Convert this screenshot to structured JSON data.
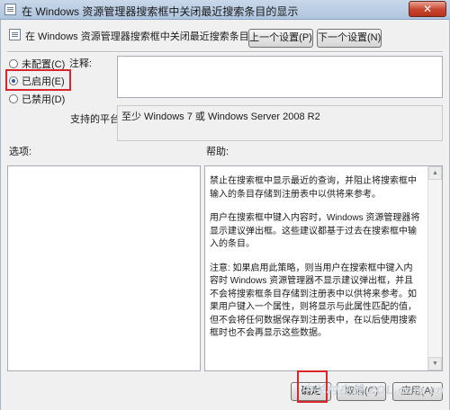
{
  "window": {
    "title": "在 Windows 资源管理器搜索框中关闭最近搜索条目的显示",
    "close_symbol": "✕"
  },
  "header": {
    "title": "在 Windows 资源管理器搜索框中关闭最近搜索条目的显示",
    "prev_button": "上一个设置(P)",
    "next_button": "下一个设置(N)"
  },
  "state_options": [
    {
      "label": "未配置(C)",
      "checked": false
    },
    {
      "label": "已启用(E)",
      "checked": true
    },
    {
      "label": "已禁用(D)",
      "checked": false
    }
  ],
  "comment": {
    "label": "注释:",
    "value": ""
  },
  "supported_on": {
    "label": "支持的平台:",
    "value": "至少 Windows 7 或 Windows Server 2008 R2"
  },
  "options": {
    "label": "选项:"
  },
  "help": {
    "label": "帮助:",
    "paragraphs": [
      "禁止在搜索框中显示最近的查询，并阻止将搜索框中输入的条目存储到注册表中以供将来参考。",
      "用户在搜索框中键入内容时，Windows 资源管理器将显示建议弹出框。这些建议都基于过去在搜索框中输入的条目。",
      "注意: 如果启用此策略，则当用户在搜索框中键入内容时 Windows 资源管理器不显示建议弹出框，并且不会将搜索框条目存储到注册表中以供将来参考。如果用户键入一个属性，则将显示与此属性匹配的值，但不会将任何数据保存到注册表中，在以后使用搜索框时也不会再显示这些数据。"
    ]
  },
  "footer": {
    "ok_button": "确定",
    "cancel_button": "取消(C)",
    "apply_button": "应用(A)"
  },
  "watermark": "中关村在线 ZOL.com.cn",
  "colors": {
    "highlight": "#d9262b",
    "title_gradient": "#aec4de"
  }
}
